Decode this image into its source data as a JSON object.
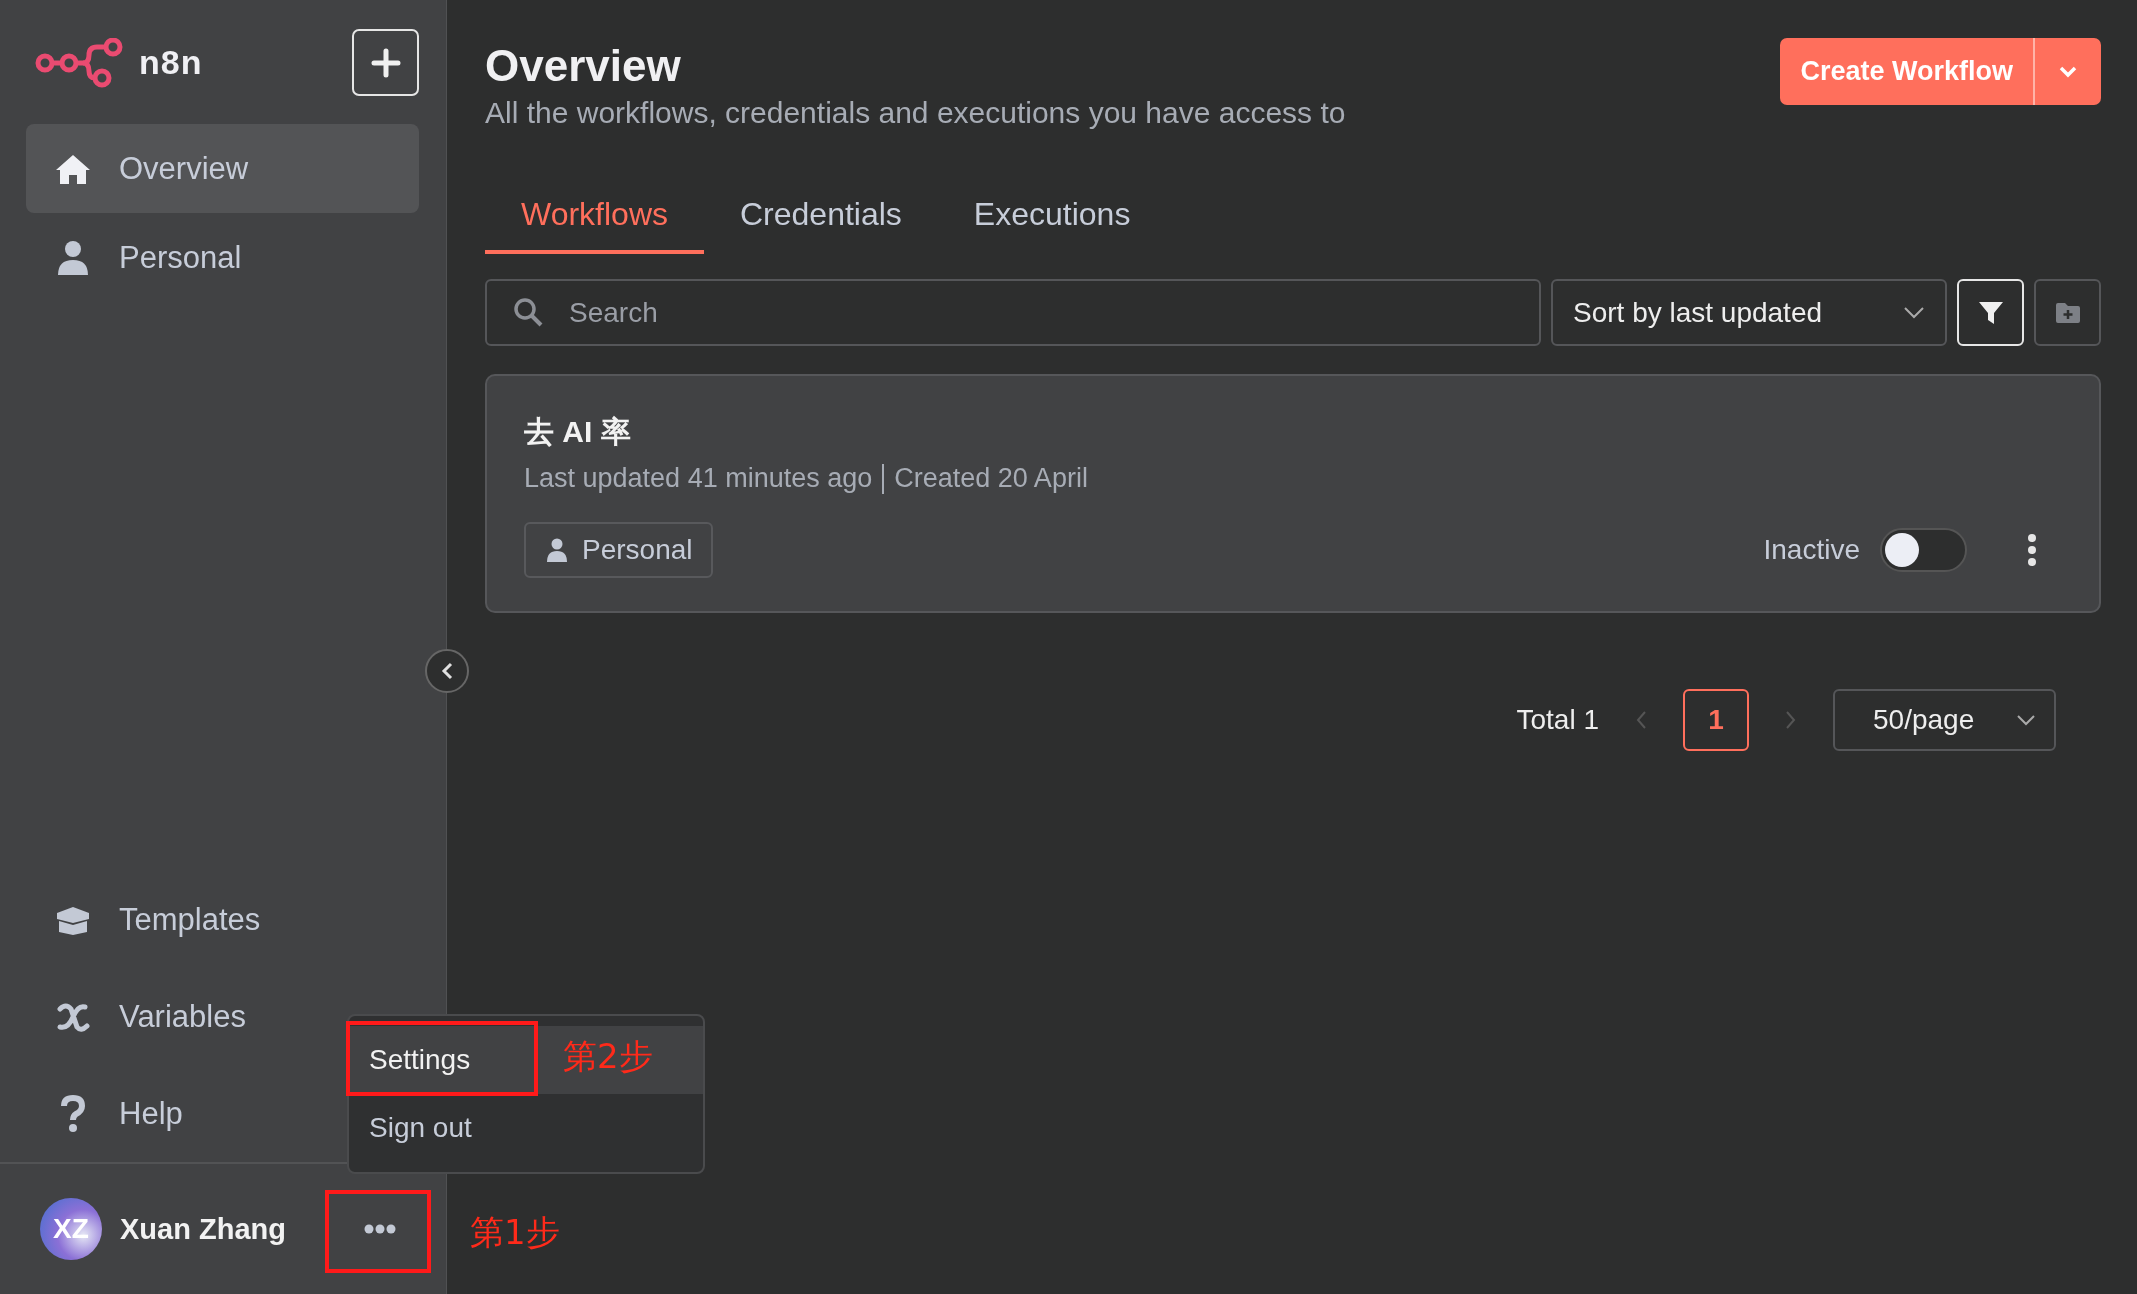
{
  "sidebar": {
    "logo_text": "n8n",
    "nav_items": [
      {
        "label": "Overview",
        "kind": "home",
        "selected": true
      },
      {
        "label": "Personal",
        "kind": "person",
        "selected": false
      }
    ],
    "bottom_items": [
      {
        "label": "Templates",
        "kind": "box"
      },
      {
        "label": "Variables",
        "kind": "variable"
      },
      {
        "label": "Help",
        "kind": "help"
      }
    ],
    "user": {
      "initials": "XZ",
      "name": "Xuan Zhang"
    }
  },
  "user_menu": {
    "items": [
      {
        "label": "Settings",
        "selected": true
      },
      {
        "label": "Sign out",
        "selected": false
      }
    ]
  },
  "annotations": [
    {
      "text": "第1步",
      "kind": "button"
    },
    {
      "text": "第2步",
      "kind": "menu"
    }
  ],
  "header": {
    "title": "Overview",
    "subtitle": "All the workflows, credentials and executions you have access to",
    "create_button": "Create Workflow"
  },
  "tabs": [
    {
      "label": "Workflows",
      "selected": true
    },
    {
      "label": "Credentials",
      "selected": false
    },
    {
      "label": "Executions",
      "selected": false
    }
  ],
  "toolbar": {
    "search_placeholder": "Search",
    "sort": "Sort by last updated"
  },
  "workflows": [
    {
      "name": "去 AI 率",
      "updated": "Last updated 41 minutes ago",
      "created": "Created 20 April",
      "project": "Personal",
      "status": "Inactive",
      "active": false
    }
  ],
  "pagination": {
    "total": "Total 1",
    "pages": [
      {
        "label": "1",
        "selected": true
      }
    ],
    "page_size": "50/page"
  }
}
